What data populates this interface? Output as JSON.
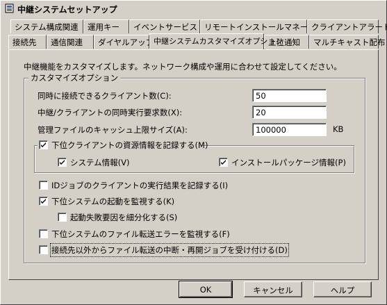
{
  "window": {
    "title": "中継システムセットアップ"
  },
  "tabs_row1": [
    {
      "label": "システム構成関連"
    },
    {
      "label": "運用キー"
    },
    {
      "label": "イベントサービス"
    },
    {
      "label": "リモートインストールマネージャ"
    },
    {
      "label": "クライアントアラート"
    }
  ],
  "tabs_row2": [
    {
      "label": "接続先"
    },
    {
      "label": "通信関連"
    },
    {
      "label": "ダイヤルアップ"
    },
    {
      "label": "中継システムカスタマイズオプション"
    },
    {
      "label": "上位通知"
    },
    {
      "label": "マルチキャスト配布"
    }
  ],
  "description": "中継機能をカスタマイズします。ネットワーク構成や運用に合わせて設定してください。",
  "group_title": "カスタマイズオプション",
  "fields": {
    "simultaneous_clients": {
      "label": "同時に接続できるクライアント数(C):",
      "value": "50"
    },
    "concurrent_requests": {
      "label": "中継/クライアントの同時実行要求数(X):",
      "value": "20"
    },
    "cache_limit": {
      "label": "管理ファイルのキャッシュ上限サイズ(A):",
      "value": "100000",
      "unit": "KB"
    }
  },
  "checkboxes": {
    "record_resources": {
      "label": "下位クライアントの資源情報を記録する(M)",
      "checked": true
    },
    "system_info": {
      "label": "システム情報(V)",
      "checked": true
    },
    "install_package_info": {
      "label": "インストールパッケージ情報(P)",
      "checked": true
    },
    "record_id_job": {
      "label": "IDジョブのクライアントの実行結果を記録する(I)",
      "checked": false
    },
    "monitor_startup": {
      "label": "下位システムの起動を監視する(K)",
      "checked": true
    },
    "detail_failure": {
      "label": "起動失敗要因を細分化する(S)",
      "checked": false
    },
    "monitor_transfer_error": {
      "label": "下位システムのファイル転送エラーを監視する(F)",
      "checked": false
    },
    "accept_other": {
      "label": "接続先以外からファイル転送の中断・再開ジョブを受け付ける(D)",
      "checked": false
    }
  },
  "buttons": {
    "ok": "OK",
    "cancel": "キャンセル",
    "help": "ヘルプ"
  }
}
